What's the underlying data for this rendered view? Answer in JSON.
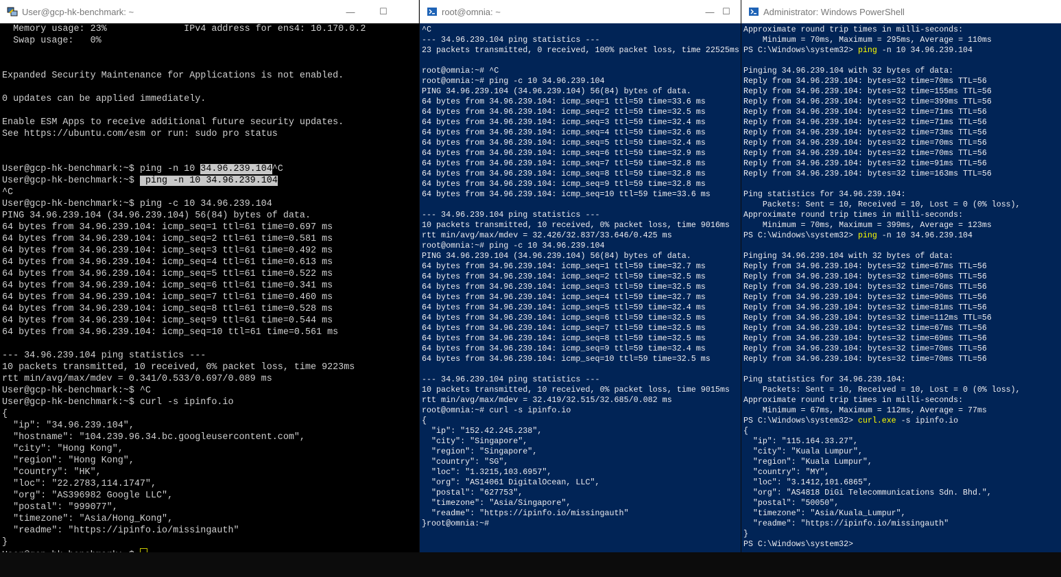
{
  "windows": [
    {
      "title": "User@gcp-hk-benchmark: ~",
      "lines": [
        {
          "t": "  Memory usage: 23%              IPv4 address for ens4: 10.170.0.2"
        },
        {
          "t": "  Swap usage:   0%"
        },
        {
          "t": ""
        },
        {
          "t": ""
        },
        {
          "t": "Expanded Security Maintenance for Applications is not enabled."
        },
        {
          "t": ""
        },
        {
          "t": "0 updates can be applied immediately."
        },
        {
          "t": ""
        },
        {
          "t": "Enable ESM Apps to receive additional future security updates."
        },
        {
          "t": "See https://ubuntu.com/esm or run: sudo pro status"
        },
        {
          "t": ""
        },
        {
          "t": ""
        },
        {
          "t": "User@gcp-hk-benchmark:~$ ping -n 10 ",
          "h": "34.96.239.104",
          "a": "^C"
        },
        {
          "t": "User@gcp-hk-benchmark:~$ ",
          "h": " ping -n 10 34.96.239.104",
          "a": ""
        },
        {
          "t": "^C"
        },
        {
          "t": "User@gcp-hk-benchmark:~$ ping -c 10 34.96.239.104"
        },
        {
          "t": "PING 34.96.239.104 (34.96.239.104) 56(84) bytes of data."
        },
        {
          "t": "64 bytes from 34.96.239.104: icmp_seq=1 ttl=61 time=0.697 ms"
        },
        {
          "t": "64 bytes from 34.96.239.104: icmp_seq=2 ttl=61 time=0.581 ms"
        },
        {
          "t": "64 bytes from 34.96.239.104: icmp_seq=3 ttl=61 time=0.492 ms"
        },
        {
          "t": "64 bytes from 34.96.239.104: icmp_seq=4 ttl=61 time=0.613 ms"
        },
        {
          "t": "64 bytes from 34.96.239.104: icmp_seq=5 ttl=61 time=0.522 ms"
        },
        {
          "t": "64 bytes from 34.96.239.104: icmp_seq=6 ttl=61 time=0.341 ms"
        },
        {
          "t": "64 bytes from 34.96.239.104: icmp_seq=7 ttl=61 time=0.460 ms"
        },
        {
          "t": "64 bytes from 34.96.239.104: icmp_seq=8 ttl=61 time=0.528 ms"
        },
        {
          "t": "64 bytes from 34.96.239.104: icmp_seq=9 ttl=61 time=0.544 ms"
        },
        {
          "t": "64 bytes from 34.96.239.104: icmp_seq=10 ttl=61 time=0.561 ms"
        },
        {
          "t": ""
        },
        {
          "t": "--- 34.96.239.104 ping statistics ---"
        },
        {
          "t": "10 packets transmitted, 10 received, 0% packet loss, time 9223ms"
        },
        {
          "t": "rtt min/avg/max/mdev = 0.341/0.533/0.697/0.089 ms"
        },
        {
          "t": "User@gcp-hk-benchmark:~$ ^C"
        },
        {
          "t": "User@gcp-hk-benchmark:~$ curl -s ipinfo.io"
        },
        {
          "t": "{"
        },
        {
          "t": "  \"ip\": \"34.96.239.104\","
        },
        {
          "t": "  \"hostname\": \"104.239.96.34.bc.googleusercontent.com\","
        },
        {
          "t": "  \"city\": \"Hong Kong\","
        },
        {
          "t": "  \"region\": \"Hong Kong\","
        },
        {
          "t": "  \"country\": \"HK\","
        },
        {
          "t": "  \"loc\": \"22.2783,114.1747\","
        },
        {
          "t": "  \"org\": \"AS396982 Google LLC\","
        },
        {
          "t": "  \"postal\": \"999077\","
        },
        {
          "t": "  \"timezone\": \"Asia/Hong_Kong\","
        },
        {
          "t": "  \"readme\": \"https://ipinfo.io/missingauth\""
        },
        {
          "t": "}"
        },
        {
          "t": "User@gcp-hk-benchmark:~$ ",
          "cursor": true
        }
      ]
    },
    {
      "title": "root@omnia: ~",
      "lines": [
        {
          "t": "^C"
        },
        {
          "t": "--- 34.96.239.104 ping statistics ---"
        },
        {
          "t": "23 packets transmitted, 0 received, 100% packet loss, time 22525ms"
        },
        {
          "t": ""
        },
        {
          "t": "root@omnia:~# ^C"
        },
        {
          "t": "root@omnia:~# ping -c 10 34.96.239.104"
        },
        {
          "t": "PING 34.96.239.104 (34.96.239.104) 56(84) bytes of data."
        },
        {
          "t": "64 bytes from 34.96.239.104: icmp_seq=1 ttl=59 time=33.6 ms"
        },
        {
          "t": "64 bytes from 34.96.239.104: icmp_seq=2 ttl=59 time=32.5 ms"
        },
        {
          "t": "64 bytes from 34.96.239.104: icmp_seq=3 ttl=59 time=32.4 ms"
        },
        {
          "t": "64 bytes from 34.96.239.104: icmp_seq=4 ttl=59 time=32.6 ms"
        },
        {
          "t": "64 bytes from 34.96.239.104: icmp_seq=5 ttl=59 time=32.4 ms"
        },
        {
          "t": "64 bytes from 34.96.239.104: icmp_seq=6 ttl=59 time=32.9 ms"
        },
        {
          "t": "64 bytes from 34.96.239.104: icmp_seq=7 ttl=59 time=32.8 ms"
        },
        {
          "t": "64 bytes from 34.96.239.104: icmp_seq=8 ttl=59 time=32.8 ms"
        },
        {
          "t": "64 bytes from 34.96.239.104: icmp_seq=9 ttl=59 time=32.8 ms"
        },
        {
          "t": "64 bytes from 34.96.239.104: icmp_seq=10 ttl=59 time=33.6 ms"
        },
        {
          "t": ""
        },
        {
          "t": "--- 34.96.239.104 ping statistics ---"
        },
        {
          "t": "10 packets transmitted, 10 received, 0% packet loss, time 9016ms"
        },
        {
          "t": "rtt min/avg/max/mdev = 32.426/32.837/33.646/0.425 ms"
        },
        {
          "t": "root@omnia:~# ping -c 10 34.96.239.104"
        },
        {
          "t": "PING 34.96.239.104 (34.96.239.104) 56(84) bytes of data."
        },
        {
          "t": "64 bytes from 34.96.239.104: icmp_seq=1 ttl=59 time=32.7 ms"
        },
        {
          "t": "64 bytes from 34.96.239.104: icmp_seq=2 ttl=59 time=32.5 ms"
        },
        {
          "t": "64 bytes from 34.96.239.104: icmp_seq=3 ttl=59 time=32.5 ms"
        },
        {
          "t": "64 bytes from 34.96.239.104: icmp_seq=4 ttl=59 time=32.7 ms"
        },
        {
          "t": "64 bytes from 34.96.239.104: icmp_seq=5 ttl=59 time=32.4 ms"
        },
        {
          "t": "64 bytes from 34.96.239.104: icmp_seq=6 ttl=59 time=32.5 ms"
        },
        {
          "t": "64 bytes from 34.96.239.104: icmp_seq=7 ttl=59 time=32.5 ms"
        },
        {
          "t": "64 bytes from 34.96.239.104: icmp_seq=8 ttl=59 time=32.5 ms"
        },
        {
          "t": "64 bytes from 34.96.239.104: icmp_seq=9 ttl=59 time=32.4 ms"
        },
        {
          "t": "64 bytes from 34.96.239.104: icmp_seq=10 ttl=59 time=32.5 ms"
        },
        {
          "t": ""
        },
        {
          "t": "--- 34.96.239.104 ping statistics ---"
        },
        {
          "t": "10 packets transmitted, 10 received, 0% packet loss, time 9015ms"
        },
        {
          "t": "rtt min/avg/max/mdev = 32.419/32.515/32.685/0.082 ms"
        },
        {
          "t": "root@omnia:~# curl -s ipinfo.io"
        },
        {
          "t": "{"
        },
        {
          "t": "  \"ip\": \"152.42.245.238\","
        },
        {
          "t": "  \"city\": \"Singapore\","
        },
        {
          "t": "  \"region\": \"Singapore\","
        },
        {
          "t": "  \"country\": \"SG\","
        },
        {
          "t": "  \"loc\": \"1.3215,103.6957\","
        },
        {
          "t": "  \"org\": \"AS14061 DigitalOcean, LLC\","
        },
        {
          "t": "  \"postal\": \"627753\","
        },
        {
          "t": "  \"timezone\": \"Asia/Singapore\","
        },
        {
          "t": "  \"readme\": \"https://ipinfo.io/missingauth\""
        },
        {
          "t": "}root@omnia:~#"
        }
      ]
    },
    {
      "title": "Administrator: Windows PowerShell",
      "lines": [
        {
          "t": "Approximate round trip times in milli-seconds:"
        },
        {
          "t": "    Minimum = 70ms, Maximum = 295ms, Average = 110ms"
        },
        {
          "t": "PS C:\\Windows\\system32> ",
          "c": "ping",
          "a": " -n 10 34.96.239.104"
        },
        {
          "t": ""
        },
        {
          "t": "Pinging 34.96.239.104 with 32 bytes of data:"
        },
        {
          "t": "Reply from 34.96.239.104: bytes=32 time=70ms TTL=56"
        },
        {
          "t": "Reply from 34.96.239.104: bytes=32 time=155ms TTL=56"
        },
        {
          "t": "Reply from 34.96.239.104: bytes=32 time=399ms TTL=56"
        },
        {
          "t": "Reply from 34.96.239.104: bytes=32 time=71ms TTL=56"
        },
        {
          "t": "Reply from 34.96.239.104: bytes=32 time=71ms TTL=56"
        },
        {
          "t": "Reply from 34.96.239.104: bytes=32 time=73ms TTL=56"
        },
        {
          "t": "Reply from 34.96.239.104: bytes=32 time=70ms TTL=56"
        },
        {
          "t": "Reply from 34.96.239.104: bytes=32 time=70ms TTL=56"
        },
        {
          "t": "Reply from 34.96.239.104: bytes=32 time=91ms TTL=56"
        },
        {
          "t": "Reply from 34.96.239.104: bytes=32 time=163ms TTL=56"
        },
        {
          "t": ""
        },
        {
          "t": "Ping statistics for 34.96.239.104:"
        },
        {
          "t": "    Packets: Sent = 10, Received = 10, Lost = 0 (0% loss),"
        },
        {
          "t": "Approximate round trip times in milli-seconds:"
        },
        {
          "t": "    Minimum = 70ms, Maximum = 399ms, Average = 123ms"
        },
        {
          "t": "PS C:\\Windows\\system32> ",
          "c": "ping",
          "a": " -n 10 34.96.239.104"
        },
        {
          "t": ""
        },
        {
          "t": "Pinging 34.96.239.104 with 32 bytes of data:"
        },
        {
          "t": "Reply from 34.96.239.104: bytes=32 time=67ms TTL=56"
        },
        {
          "t": "Reply from 34.96.239.104: bytes=32 time=69ms TTL=56"
        },
        {
          "t": "Reply from 34.96.239.104: bytes=32 time=76ms TTL=56"
        },
        {
          "t": "Reply from 34.96.239.104: bytes=32 time=90ms TTL=56"
        },
        {
          "t": "Reply from 34.96.239.104: bytes=32 time=81ms TTL=56"
        },
        {
          "t": "Reply from 34.96.239.104: bytes=32 time=112ms TTL=56"
        },
        {
          "t": "Reply from 34.96.239.104: bytes=32 time=67ms TTL=56"
        },
        {
          "t": "Reply from 34.96.239.104: bytes=32 time=69ms TTL=56"
        },
        {
          "t": "Reply from 34.96.239.104: bytes=32 time=70ms TTL=56"
        },
        {
          "t": "Reply from 34.96.239.104: bytes=32 time=70ms TTL=56"
        },
        {
          "t": ""
        },
        {
          "t": "Ping statistics for 34.96.239.104:"
        },
        {
          "t": "    Packets: Sent = 10, Received = 10, Lost = 0 (0% loss),"
        },
        {
          "t": "Approximate round trip times in milli-seconds:"
        },
        {
          "t": "    Minimum = 67ms, Maximum = 112ms, Average = 77ms"
        },
        {
          "t": "PS C:\\Windows\\system32> ",
          "c": "curl.exe",
          "a": " -s ipinfo.io"
        },
        {
          "t": "{"
        },
        {
          "t": "  \"ip\": \"115.164.33.27\","
        },
        {
          "t": "  \"city\": \"Kuala Lumpur\","
        },
        {
          "t": "  \"region\": \"Kuala Lumpur\","
        },
        {
          "t": "  \"country\": \"MY\","
        },
        {
          "t": "  \"loc\": \"3.1412,101.6865\","
        },
        {
          "t": "  \"org\": \"AS4818 DiGi Telecommunications Sdn. Bhd.\","
        },
        {
          "t": "  \"postal\": \"50050\","
        },
        {
          "t": "  \"timezone\": \"Asia/Kuala_Lumpur\","
        },
        {
          "t": "  \"readme\": \"https://ipinfo.io/missingauth\""
        },
        {
          "t": "}"
        },
        {
          "t": "PS C:\\Windows\\system32>"
        }
      ]
    }
  ],
  "controls": {
    "minimize": "—",
    "maximize": "☐"
  }
}
